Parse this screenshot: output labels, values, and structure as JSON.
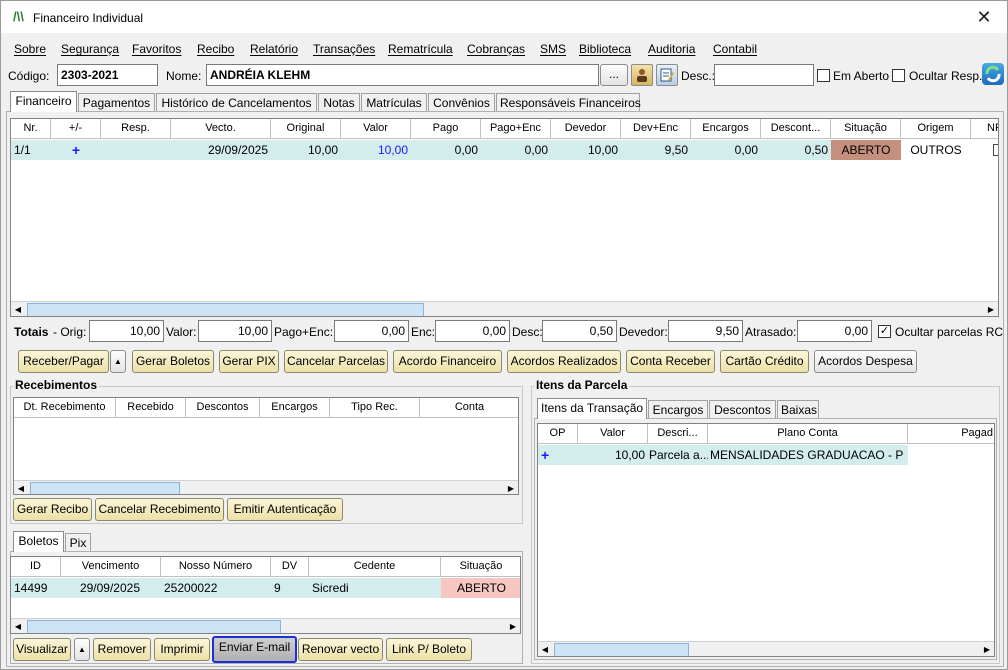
{
  "window": {
    "title": "Financeiro Individual",
    "close_glyph": "✕"
  },
  "menu": [
    "Sobre",
    "Segurança",
    "Favoritos",
    "Recibo",
    "Relatório",
    "Transações",
    "Rematrícula",
    "Cobranças",
    "SMS",
    "Biblioteca",
    "Auditoria",
    "Contabil"
  ],
  "header": {
    "codigo_label": "Código:",
    "codigo_value": "2303-2021",
    "nome_label": "Nome:",
    "nome_value": "ANDRÉIA KLEHM",
    "ellipsis": "...",
    "desc_label": "Desc.:",
    "desc_value": "",
    "em_aberto_label": "Em Aberto",
    "em_aberto_checked": false,
    "ocultar_resp_label": "Ocultar Resp.",
    "ocultar_resp_checked": false
  },
  "tabs": [
    "Financeiro",
    "Pagamentos",
    "Histórico de Cancelamentos",
    "Notas",
    "Matrículas",
    "Convênios",
    "Responsáveis Financeiros"
  ],
  "main_grid": {
    "columns": [
      "Nr.",
      "+/-",
      "Resp.",
      "Vecto.",
      "Original",
      "Valor",
      "Pago",
      "Pago+Enc",
      "Devedor",
      "Dev+Enc",
      "Encargos",
      "Descont...",
      "Situação",
      "Origem",
      "NF"
    ],
    "rows": [
      {
        "nr": "1/1",
        "plus": "+",
        "resp": "",
        "vecto": "29/09/2025",
        "original": "10,00",
        "valor": "10,00",
        "pago": "0,00",
        "pago_enc": "0,00",
        "devedor": "10,00",
        "dev_enc": "9,50",
        "encargos": "0,00",
        "descontos": "0,50",
        "situacao": "ABERTO",
        "origem": "OUTROS"
      }
    ]
  },
  "totais": {
    "label": "Totais",
    "orig_label": "- Orig:",
    "orig": "10,00",
    "valor_label": "Valor:",
    "valor": "10,00",
    "pago_enc_label": "Pago+Enc:",
    "pago_enc": "0,00",
    "enc_label": "Enc:",
    "enc": "0,00",
    "desc_label": "Desc:",
    "desc": "0,50",
    "devedor_label": "Devedor:",
    "devedor": "9,50",
    "atrasado_label": "Atrasado:",
    "atrasado": "0,00",
    "ocultar_label": "Ocultar parcelas RC",
    "ocultar_checked": true
  },
  "actions": [
    "Receber/Pagar",
    "Gerar Boletos",
    "Gerar PIX",
    "Cancelar Parcelas",
    "Acordo Financeiro",
    "Acordos Realizados",
    "Conta Receber",
    "Cartão Crédito",
    "Acordos Despesa"
  ],
  "recebimentos": {
    "title": "Recebimentos",
    "columns": [
      "Dt. Recebimento",
      "Recebido",
      "Descontos",
      "Encargos",
      "Tipo Rec.",
      "Conta"
    ],
    "buttons": [
      "Gerar Recibo",
      "Cancelar Recebimento",
      "Emitir Autenticação"
    ]
  },
  "boletos": {
    "tabs": [
      "Boletos",
      "Pix"
    ],
    "columns": [
      "ID",
      "Vencimento",
      "Nosso Número",
      "DV",
      "Cedente",
      "Situação"
    ],
    "rows": [
      {
        "id": "14499",
        "vencimento": "29/09/2025",
        "nosso_numero": "25200022",
        "dv": "9",
        "cedente": "Sicredi",
        "situacao": "ABERTO"
      }
    ],
    "buttons": [
      "Visualizar",
      "Remover",
      "Imprimir",
      "Enviar E-mail",
      "Renovar vecto",
      "Link P/ Boleto"
    ]
  },
  "itens_parcela": {
    "title": "Itens da Parcela",
    "tabs": [
      "Itens da Transação",
      "Encargos",
      "Descontos",
      "Baixas"
    ],
    "columns": [
      "OP",
      "Valor",
      "Descri...",
      "Plano Conta",
      "Pagad"
    ],
    "rows": [
      {
        "op": "+",
        "valor": "10,00",
        "descricao": "Parcela a...",
        "plano_conta": "MENSALIDADES GRADUACAO - P"
      }
    ]
  },
  "colors": {
    "aberto_bg": "#c48f7c",
    "boleto_aberto_bg": "#f6c7c0",
    "row_selected": "#d3ecec",
    "button_bg": "#f5ebc0",
    "focus_border": "#1b2fd6"
  }
}
